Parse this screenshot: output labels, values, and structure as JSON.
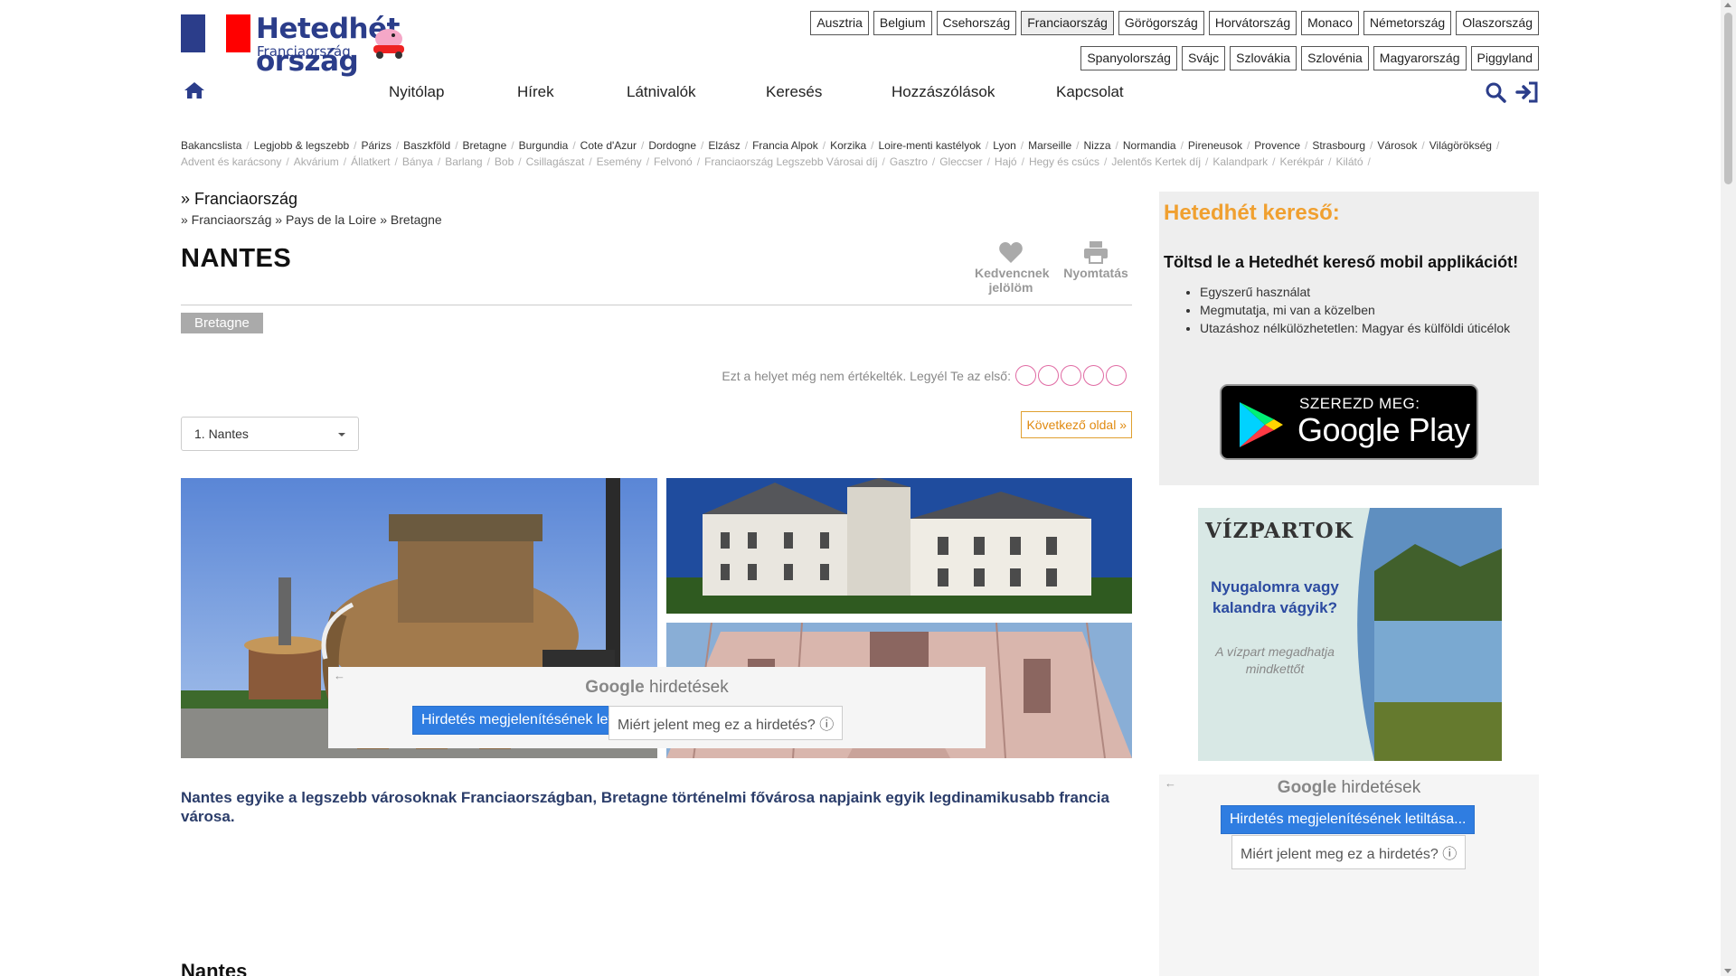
{
  "logo": {
    "title": "Hetedhét ország",
    "subtitle": "Franciaország"
  },
  "countries": [
    "Ausztria",
    "Belgium",
    "Csehország",
    "Franciaország",
    "Görögország",
    "Horvátország",
    "Monaco",
    "Németország",
    "Olaszország",
    "Spanyolország",
    "Svájc",
    "Szlovákia",
    "Szlovénia",
    "Magyarország",
    "Piggyland"
  ],
  "active_country": "Franciaország",
  "nav": [
    "Nyitólap",
    "Hírek",
    "Látnivalók",
    "Keresés",
    "Hozzászólások",
    "Kapcsolat"
  ],
  "tags_row1": [
    "Bakancslista",
    "Legjobb & legszebb",
    "Párizs",
    "Baszkföld",
    "Bretagne",
    "Burgundia",
    "Cote d'Azur",
    "Dordogne",
    "Elzász",
    "Francia Alpok",
    "Korzika",
    "Loire-menti kastélyok",
    "Lyon",
    "Marseille",
    "Nizza",
    "Normandia",
    "Pireneusok",
    "Provence",
    "Strasbourg",
    "Városok",
    "Világörökség"
  ],
  "tags_row2": [
    "Advent és karácsony",
    "Akvárium",
    "Állatkert",
    "Bánya",
    "Barlang",
    "Bob",
    "Csillagászat",
    "Esemény",
    "Felvonó",
    "Franciaország Legszebb Városai díj",
    "Gasztro",
    "Gleccser",
    "Hajó",
    "Hegy és csúcs",
    "Jelentős Kertek díj",
    "Kalandpark",
    "Kerékpár",
    "Kilátó"
  ],
  "breadcrumb": {
    "top": "» Franciaország",
    "path": "» Franciaország » Pays de la Loire » Bretagne"
  },
  "title": "NANTES",
  "actions": {
    "favorite": "Kedvencnek jelölöm",
    "print": "Nyomtatás"
  },
  "region_badge": "Bretagne",
  "rating_text": "Ezt a helyet még nem értékelték. Legyél Te az első:",
  "page_select": "1. Nantes",
  "next_page": "Következő oldal »",
  "intro": "Nantes egyike a legszebb városoknak Franciaországban, Bretagne történelmi fővárosa napjaink egyik legdinamikusabb francia városa.",
  "ads": {
    "google": "Google",
    "label": "hirdetések",
    "stop": "Hirdetés megjelenítésének letiltása...",
    "why": "Miért jelent meg ez a hirdetés? ⓘ",
    "back": "←"
  },
  "section_title": "Nantes",
  "sidebar": {
    "search_title": "Hetedhét kereső:",
    "app_text": "Töltsd le a Hetedhét kereső mobil applikációt!",
    "features": [
      "Egyszerű használat",
      "Megmutatja, mi van a közelben",
      "Utazáshoz nélkülözhetetlen: Magyar és külföldi úticélok"
    ],
    "gplay_top": "SZEREZD MEG:",
    "gplay_bottom": "Google Play"
  },
  "banner": {
    "title": "VÍZPARTOK",
    "headline": "Nyugalomra vagy kalandra vágyik?",
    "note": "A vízpart megadhatja mindkettőt"
  },
  "colors": {
    "brand": "#2b3d8a",
    "accent_orange": "#f0a030",
    "ad_blue": "#2f7de1"
  }
}
